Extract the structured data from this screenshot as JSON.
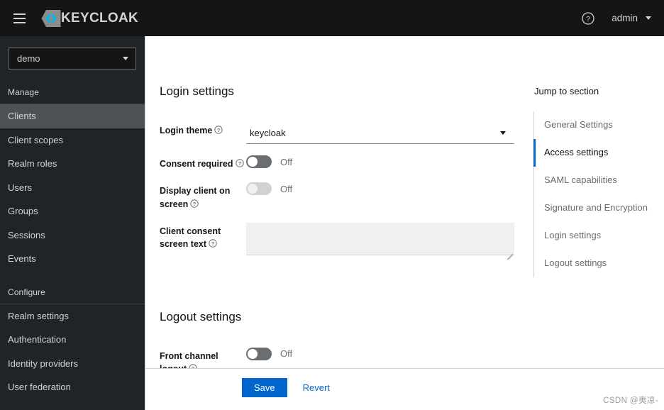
{
  "masthead": {
    "hamburger_icon": "hamburger-menu-icon",
    "brand_text": "KEYCLOAK",
    "logo_icon": "keycloak-logo-icon",
    "help_icon": "help-circle-icon",
    "user_name": "admin",
    "user_caret_icon": "chevron-down-icon"
  },
  "sidebar": {
    "realm_select": {
      "value": "demo",
      "caret_icon": "chevron-down-icon"
    },
    "groups": [
      {
        "title": "Manage",
        "items": [
          {
            "label": "Clients",
            "active": true
          },
          {
            "label": "Client scopes",
            "active": false
          },
          {
            "label": "Realm roles",
            "active": false
          },
          {
            "label": "Users",
            "active": false
          },
          {
            "label": "Groups",
            "active": false
          },
          {
            "label": "Sessions",
            "active": false
          },
          {
            "label": "Events",
            "active": false
          }
        ]
      },
      {
        "title": "Configure",
        "items": [
          {
            "label": "Realm settings",
            "active": false
          },
          {
            "label": "Authentication",
            "active": false
          },
          {
            "label": "Identity providers",
            "active": false
          },
          {
            "label": "User federation",
            "active": false
          }
        ]
      }
    ]
  },
  "main": {
    "login_settings": {
      "title": "Login settings",
      "login_theme": {
        "label": "Login theme",
        "value": "keycloak",
        "help_icon": "help-circle-icon",
        "caret_icon": "caret-down-icon"
      },
      "consent_required": {
        "label": "Consent required",
        "state_label": "Off",
        "help_icon": "help-circle-icon"
      },
      "display_client_on_screen": {
        "label": "Display client on screen",
        "state_label": "Off",
        "help_icon": "help-circle-icon"
      },
      "client_consent_screen_text": {
        "label": "Client consent screen text",
        "value": "",
        "help_icon": "help-circle-icon",
        "resize_icon": "resize-grip-icon"
      }
    },
    "logout_settings": {
      "title": "Logout settings",
      "front_channel_logout": {
        "label": "Front channel logout",
        "state_label": "Off",
        "help_icon": "help-circle-icon"
      }
    }
  },
  "jump_to_section": {
    "title": "Jump to section",
    "items": [
      {
        "label": "General Settings",
        "active": false
      },
      {
        "label": "Access settings",
        "active": true
      },
      {
        "label": "SAML capabilities",
        "active": false
      },
      {
        "label": "Signature and Encryption",
        "active": false
      },
      {
        "label": "Login settings",
        "active": false
      },
      {
        "label": "Logout settings",
        "active": false
      }
    ]
  },
  "footer": {
    "save_label": "Save",
    "revert_label": "Revert"
  },
  "watermark": "CSDN @夷凉-",
  "colors": {
    "accent_blue": "#0066cc",
    "masthead_bg": "#151515",
    "sidebar_bg": "#212427",
    "sidebar_active_bg": "#4f5255",
    "toggle_off": "#6a6e73",
    "toggle_disabled": "#d2d2d2"
  }
}
